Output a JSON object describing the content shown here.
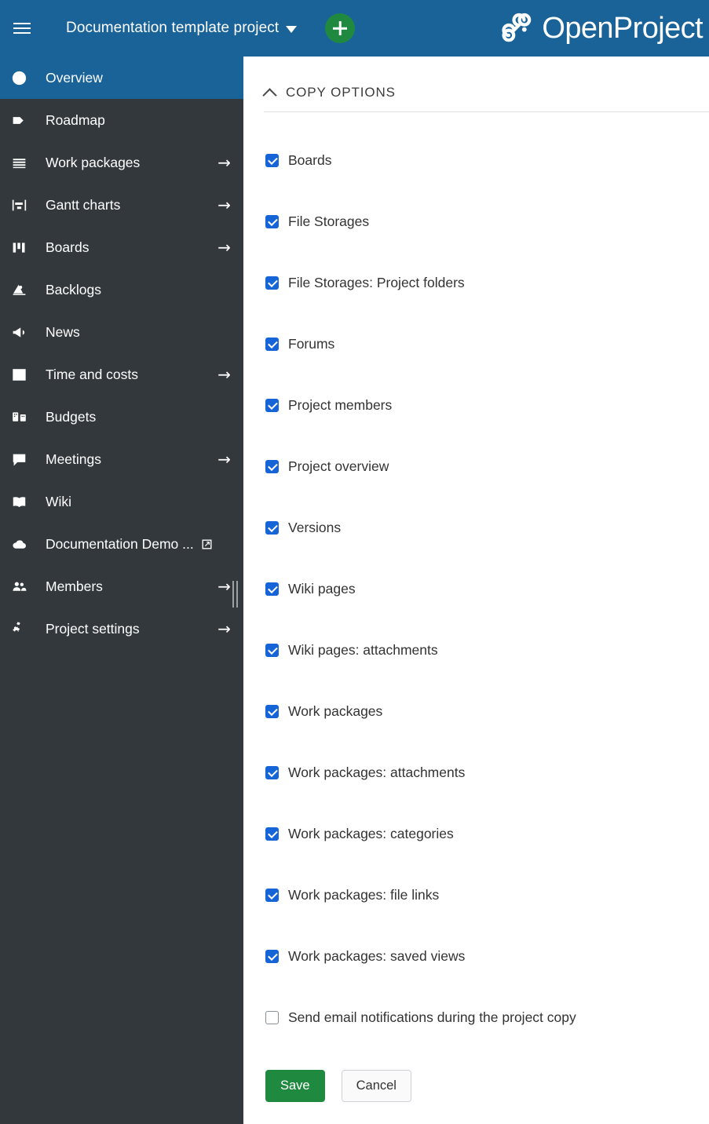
{
  "header": {
    "menu_icon": "hamburger-icon",
    "project_name": "Documentation template project",
    "dropdown_icon": "caret-down-icon",
    "add_button_label": "+",
    "add_button_icon": "plus-icon",
    "brand_name": "OpenProject",
    "brand_logo_icon": "openproject-logo-icon",
    "background_color": "#1A6399",
    "accent_green": "#1F8A3F"
  },
  "sidebar": {
    "background_color": "#33383D",
    "active_color": "#1A6399",
    "items": [
      {
        "label": "Overview",
        "icon": "info-circle-icon",
        "active": true,
        "arrow": "",
        "external": false
      },
      {
        "label": "Roadmap",
        "icon": "tag-icon",
        "active": false,
        "arrow": "",
        "external": false
      },
      {
        "label": "Work packages",
        "icon": "list-lines-icon",
        "active": false,
        "arrow": "→",
        "external": false
      },
      {
        "label": "Gantt charts",
        "icon": "gantt-chart-icon",
        "active": false,
        "arrow": "→",
        "external": false
      },
      {
        "label": "Boards",
        "icon": "board-columns-icon",
        "active": false,
        "arrow": "→",
        "external": false
      },
      {
        "label": "Backlogs",
        "icon": "backlogs-icon",
        "active": false,
        "arrow": "",
        "external": false
      },
      {
        "label": "News",
        "icon": "megaphone-icon",
        "active": false,
        "arrow": "",
        "external": false
      },
      {
        "label": "Time and costs",
        "icon": "bar-chart-icon",
        "active": false,
        "arrow": "→",
        "external": false
      },
      {
        "label": "Budgets",
        "icon": "budgets-icon",
        "active": false,
        "arrow": "",
        "external": false
      },
      {
        "label": "Meetings",
        "icon": "speech-bubble-icon",
        "active": false,
        "arrow": "→",
        "external": false
      },
      {
        "label": "Wiki",
        "icon": "book-icon",
        "active": false,
        "arrow": "",
        "external": false
      },
      {
        "label": "Documentation Demo ...",
        "icon": "cloud-icon",
        "active": false,
        "arrow": "",
        "external": true
      },
      {
        "label": "Members",
        "icon": "people-icon",
        "active": false,
        "arrow": "→",
        "external": false
      },
      {
        "label": "Project settings",
        "icon": "gears-icon",
        "active": false,
        "arrow": "→",
        "external": false
      }
    ]
  },
  "main": {
    "section": {
      "title": "COPY OPTIONS",
      "collapse_icon": "chevron-up-icon"
    },
    "options": [
      {
        "label": "Boards",
        "checked": true
      },
      {
        "label": "File Storages",
        "checked": true
      },
      {
        "label": "File Storages: Project folders",
        "checked": true
      },
      {
        "label": "Forums",
        "checked": true
      },
      {
        "label": "Project members",
        "checked": true
      },
      {
        "label": "Project overview",
        "checked": true
      },
      {
        "label": "Versions",
        "checked": true
      },
      {
        "label": "Wiki pages",
        "checked": true
      },
      {
        "label": "Wiki pages: attachments",
        "checked": true
      },
      {
        "label": "Work packages",
        "checked": true
      },
      {
        "label": "Work packages: attachments",
        "checked": true
      },
      {
        "label": "Work packages: categories",
        "checked": true
      },
      {
        "label": "Work packages: file links",
        "checked": true
      },
      {
        "label": "Work packages: saved views",
        "checked": true
      },
      {
        "label": "Send email notifications during the project copy",
        "checked": false
      }
    ],
    "checkbox_color": "#1665D8",
    "buttons": {
      "save": "Save",
      "cancel": "Cancel"
    }
  }
}
